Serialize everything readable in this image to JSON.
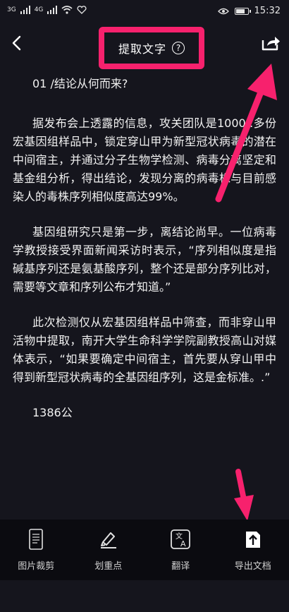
{
  "status_bar": {
    "left_signal_1": "3G",
    "left_signal_2": "4G",
    "time": "15:32"
  },
  "header": {
    "title": "提取文字",
    "help_glyph": "?"
  },
  "article": {
    "section_title": "01 /结论从何而来?",
    "paragraphs": [
      "据发布会上透露的信息，攻关团队是1000 .多份宏基因组样品中，锁定穿山甲为新型冠状病毒的潜在中间宿主，并通过分子生物学检测、病毒分离坚定和基金组分析，得出结论，发现分离的病毒株与目前感染人的毒株序列相似度高达99%。",
      "基因组研究只是第一步，离结论尚早。一位病毒学教授接受界面新闻采访时表示，“序列相似度是指碱基序列还是氨基酸序列，整个还是部分序列比对，需要等文章和序列公布才知道。”",
      "此次检测仅从宏基因组样品中筛查，而非穿山甲活物中提取，南开大学生命科学学院副教授高山对媒体表示，“如果要确定中间宿主，首先要从穿山甲中得到新型冠状病毒的全基因组序列，这是金标准。.”"
    ],
    "tail_text": "1386公"
  },
  "toolbar": {
    "items": [
      {
        "label": "图片裁剪",
        "icon": "image-crop-icon"
      },
      {
        "label": "划重点",
        "icon": "highlight-pen-icon"
      },
      {
        "label": "翻译",
        "icon": "translate-icon"
      },
      {
        "label": "导出文档",
        "icon": "export-document-icon"
      }
    ]
  },
  "colors": {
    "background": "#15151d",
    "toolbar_bg": "#0b0b10",
    "annotation": "#f7216d"
  }
}
